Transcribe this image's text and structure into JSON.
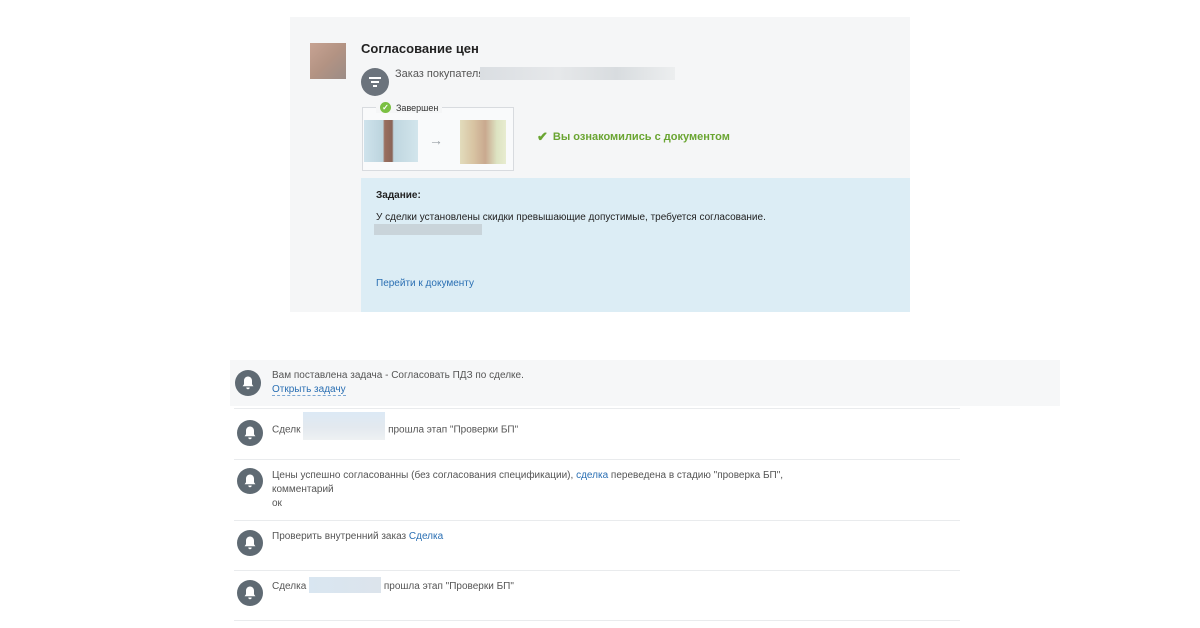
{
  "card": {
    "title": "Согласование цен",
    "order_label": "Заказ покупателя",
    "status": "Завершен",
    "done_message": "Вы ознакомились с документом",
    "task_title": "Задание:",
    "task_description": "У сделки установлены скидки превышающие допустимые, требуется согласование.",
    "task_link": "Перейти к документу"
  },
  "feed": [
    {
      "text": "Вам поставлена задача - Согласовать ПДЗ по сделке.",
      "link": "Открыть задачу"
    },
    {
      "prefix": "Сделк",
      "suffix": "прошла этап \"Проверки БП\""
    },
    {
      "part1": "Цены успешно согласованны (без согласования спецификации),",
      "link": "сделка",
      "part2": "переведена в стадию \"проверка БП\",",
      "line2": "комментарий",
      "line3": "ок"
    },
    {
      "text": "Проверить внутренний заказ",
      "link": "Сделка"
    },
    {
      "prefix": "Сделка",
      "suffix": "прошла этап \"Проверки БП\""
    }
  ],
  "icons": [
    "filter-icon",
    "check-icon",
    "arrow-right-icon",
    "bell-icon"
  ],
  "colors": {
    "link": "#2a6fb3",
    "success": "#6aa532",
    "task_background": "#dcedf5",
    "icon_gray": "#5f6a73"
  }
}
